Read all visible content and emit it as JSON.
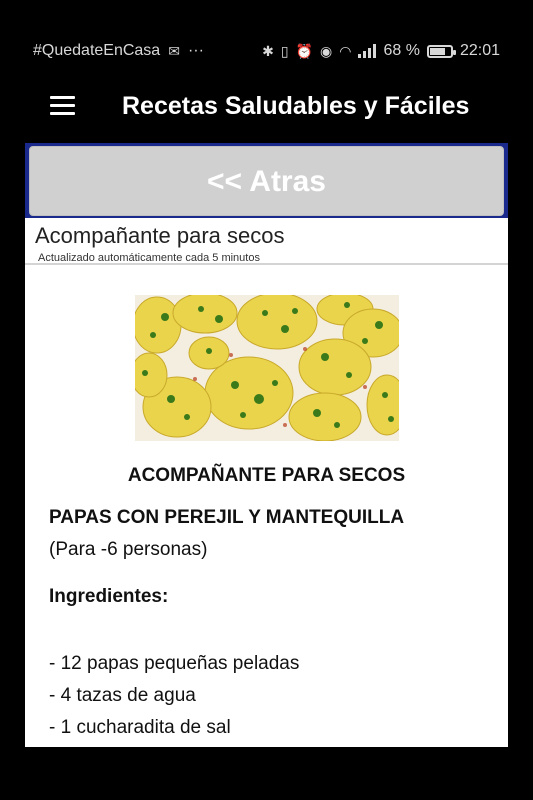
{
  "status_bar": {
    "hashtag": "#QuedateEnCasa",
    "dots": "···",
    "battery_percent_label": "68 %",
    "battery_level": 0.68,
    "time": "22:01"
  },
  "app_bar": {
    "title": "Recetas Saludables y Fáciles",
    "menu_icon": "hamburger-menu-icon"
  },
  "web": {
    "back_button_label": "<< Atras",
    "section_title": "Acompañante para secos",
    "section_subtitle": "Actualizado automáticamente cada 5 minutos"
  },
  "article": {
    "heading": "ACOMPAÑANTE PARA SECOS",
    "dish_name": "PAPAS CON PEREJIL Y MANTEQUILLA",
    "servings": "(Para -6 personas)",
    "ingredients_title": "Ingredientes:",
    "ingredients": [
      "- 12 papas pequeñas peladas",
      "- 4 tazas de agua",
      "- 1 cucharadita de sal"
    ]
  },
  "colors": {
    "background": "#000000",
    "webview_border": "#1a2a8c",
    "back_button_bg": "#d0d0d0",
    "potato": "#e8d24a",
    "parsley": "#3a7a1a"
  }
}
